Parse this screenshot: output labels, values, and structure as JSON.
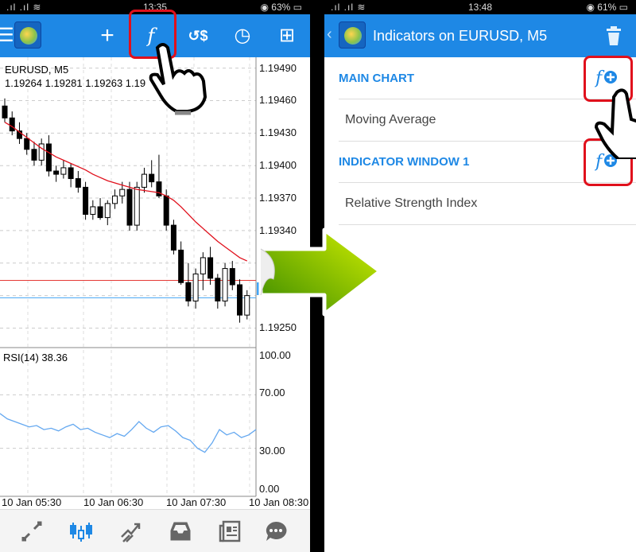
{
  "left": {
    "status": {
      "time": "13:35",
      "battery": "63%"
    },
    "toolbar": {
      "icons": [
        "menu-icon",
        "app-logo",
        "crosshair-icon",
        "function-icon",
        "trade-icon",
        "clock-icon",
        "new-document-icon"
      ]
    },
    "chart": {
      "symbol": "EURUSD, M5",
      "ohlc": "1.19264 1.19281 1.19263 1.19",
      "price_ticks": [
        "1.19490",
        "1.19460",
        "1.19430",
        "1.19400",
        "1.19370",
        "1.19340",
        "1.19250"
      ],
      "price_range": [
        1.19232,
        1.195
      ],
      "red_line": 1.19294,
      "blue_line": 1.19278,
      "current_price_tag": "1.",
      "candles": [
        [
          1.19455,
          1.19462,
          1.1944,
          1.19444
        ],
        [
          1.19444,
          1.1945,
          1.19428,
          1.19432
        ],
        [
          1.19432,
          1.1944,
          1.1942,
          1.19425
        ],
        [
          1.19425,
          1.1943,
          1.1941,
          1.19415
        ],
        [
          1.19415,
          1.19422,
          1.194,
          1.19405
        ],
        [
          1.19405,
          1.19425,
          1.194,
          1.1942
        ],
        [
          1.1942,
          1.19428,
          1.1939,
          1.19395
        ],
        [
          1.19395,
          1.194,
          1.19385,
          1.19392
        ],
        [
          1.19392,
          1.19405,
          1.19388,
          1.19398
        ],
        [
          1.19398,
          1.19402,
          1.1938,
          1.19388
        ],
        [
          1.19388,
          1.19395,
          1.19375,
          1.1938
        ],
        [
          1.1938,
          1.19385,
          1.1935,
          1.19355
        ],
        [
          1.19355,
          1.19368,
          1.1935,
          1.19362
        ],
        [
          1.19362,
          1.1937,
          1.1935,
          1.19352
        ],
        [
          1.19352,
          1.19368,
          1.19345,
          1.19365
        ],
        [
          1.19365,
          1.19378,
          1.1936,
          1.19372
        ],
        [
          1.19372,
          1.19385,
          1.19365,
          1.19378
        ],
        [
          1.19378,
          1.19385,
          1.1934,
          1.19345
        ],
        [
          1.19345,
          1.19385,
          1.1934,
          1.1938
        ],
        [
          1.1938,
          1.19398,
          1.19375,
          1.19392
        ],
        [
          1.19392,
          1.19405,
          1.1938,
          1.19385
        ],
        [
          1.19385,
          1.1941,
          1.1937,
          1.19372
        ],
        [
          1.19372,
          1.19378,
          1.1934,
          1.19345
        ],
        [
          1.19345,
          1.1935,
          1.19318,
          1.19322
        ],
        [
          1.19322,
          1.1933,
          1.1929,
          1.19292
        ],
        [
          1.19292,
          1.1931,
          1.1927,
          1.19275
        ],
        [
          1.19275,
          1.19305,
          1.19268,
          1.193
        ],
        [
          1.193,
          1.1932,
          1.19285,
          1.19315
        ],
        [
          1.19315,
          1.19325,
          1.1929,
          1.19296
        ],
        [
          1.19296,
          1.193,
          1.19268,
          1.19275
        ],
        [
          1.19275,
          1.1931,
          1.1927,
          1.19305
        ],
        [
          1.19305,
          1.19312,
          1.19285,
          1.1929
        ],
        [
          1.1929,
          1.19295,
          1.19255,
          1.19262
        ],
        [
          1.19262,
          1.19285,
          1.19258,
          1.1928
        ]
      ],
      "ma": [
        1.1944,
        1.19436,
        1.19431,
        1.19426,
        1.19421,
        1.19416,
        1.19412,
        1.19408,
        1.19405,
        1.19402,
        1.19399,
        1.19396,
        1.19392,
        1.19389,
        1.19386,
        1.19384,
        1.19382,
        1.1938,
        1.19378,
        1.19377,
        1.19376,
        1.19375,
        1.19372,
        1.19368,
        1.19362,
        1.19355,
        1.19348,
        1.19342,
        1.19336,
        1.1933,
        1.19325,
        1.1932,
        1.19315,
        1.19312
      ],
      "colors": {
        "ma": "#e0101c",
        "red_line": "#e53935",
        "blue_line": "#42a5f5"
      }
    },
    "rsi": {
      "label": "RSI(14) 38.36",
      "ticks": [
        "100.00",
        "70.00",
        "30.00",
        "0.00"
      ],
      "values": [
        56,
        52,
        50,
        48,
        46,
        47,
        44,
        45,
        43,
        46,
        48,
        44,
        45,
        42,
        40,
        38,
        41,
        39,
        44,
        50,
        45,
        42,
        46,
        47,
        43,
        38,
        36,
        30,
        27,
        34,
        44,
        40,
        42,
        38,
        40,
        44
      ],
      "color": "#64a8f0"
    },
    "time_labels": [
      "10 Jan 05:30",
      "10 Jan 06:30",
      "10 Jan 07:30",
      "10 Jan 08:30"
    ],
    "bottom_nav": [
      "quotes-icon",
      "chart-icon",
      "trade-icon",
      "history-icon",
      "news-icon",
      "messages-icon"
    ],
    "accent": "#1e88e5"
  },
  "right": {
    "status": {
      "time": "13:48",
      "battery": "61%"
    },
    "title": "Indicators on EURUSD, M5",
    "sections": [
      {
        "title": "MAIN CHART",
        "items": [
          "Moving Average"
        ]
      },
      {
        "title": "INDICATOR WINDOW 1",
        "items": [
          "Relative Strength Index"
        ]
      }
    ]
  }
}
